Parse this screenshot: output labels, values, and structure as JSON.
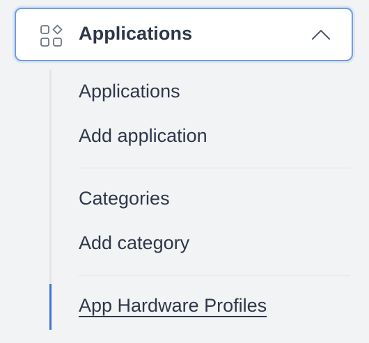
{
  "header": {
    "title": "Applications",
    "icon": "apps-grid-icon",
    "chevron": "chevron-up-icon",
    "expanded": true
  },
  "submenu": {
    "groups": [
      {
        "items": [
          {
            "label": "Applications"
          },
          {
            "label": "Add application"
          }
        ]
      },
      {
        "items": [
          {
            "label": "Categories"
          },
          {
            "label": "Add category"
          }
        ]
      },
      {
        "items": [
          {
            "label": "App Hardware Profiles",
            "active": true
          }
        ]
      }
    ]
  },
  "colors": {
    "accent": "#3b73d1",
    "header_border": "#6c9ee6",
    "text": "#2d3748",
    "background": "#f2f3f5",
    "rail": "#e3e5e9"
  }
}
